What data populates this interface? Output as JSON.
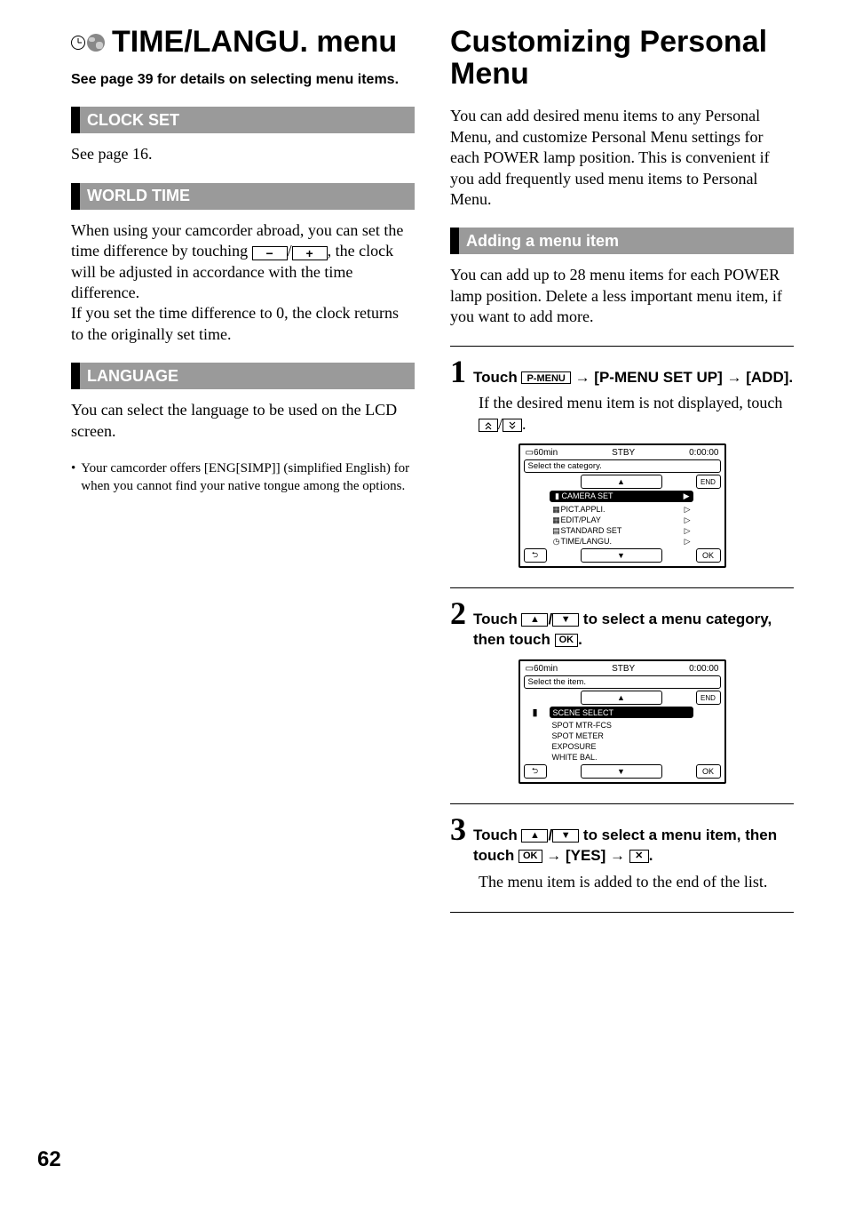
{
  "left": {
    "heading": "TIME/LANGU. menu",
    "subnote": "See page 39 for details on selecting menu items.",
    "sections": {
      "clock": {
        "title": "CLOCK SET",
        "body": "See page 16."
      },
      "world": {
        "title": "WORLD TIME",
        "body_pre": "When using your camcorder abroad, you can set the time difference by touching ",
        "body_post": ", the clock will be adjusted in accordance with the time difference.\nIf you set the time difference to 0, the clock returns to the originally set time."
      },
      "language": {
        "title": "LANGUAGE",
        "body": "You can select the language to be used on the LCD screen.",
        "bullet": "Your camcorder offers [ENG[SIMP]] (simplified English) for when you cannot find your native tongue among the options."
      }
    }
  },
  "right": {
    "heading": "Customizing Personal Menu",
    "intro": "You can add desired menu items to any Personal Menu, and customize Personal Menu settings for each POWER lamp position. This is convenient if you add frequently used menu items to Personal Menu.",
    "section_bar": "Adding a menu item",
    "add_intro": "You can add up to 28 menu items for each POWER lamp position. Delete a less important menu item, if you want to add more.",
    "steps": {
      "s1": {
        "num": "1",
        "head_pre": "Touch ",
        "pmenu": "P-MENU",
        "head_mid1": " → [P-MENU SET UP] → [ADD].",
        "sub_pre": "If the desired menu item is not displayed, touch "
      },
      "s2": {
        "num": "2",
        "head_pre": "Touch ",
        "head_mid": " to select a menu category, then touch ",
        "ok": "OK",
        "head_end": "."
      },
      "s3": {
        "num": "3",
        "head_pre": "Touch ",
        "head_mid": " to select a menu item, then touch ",
        "ok": "OK",
        "yes": " → [YES] → ",
        "head_end": ".",
        "sub": "The menu item is added to the end of the list."
      }
    },
    "lcd1": {
      "batt": "60min",
      "stby": "STBY",
      "time": "0:00:00",
      "title": "Select the category.",
      "end": "END",
      "ok": "OK",
      "items": [
        "CAMERA SET",
        "PICT.APPLI.",
        "EDIT/PLAY",
        "STANDARD SET",
        "TIME/LANGU."
      ]
    },
    "lcd2": {
      "batt": "60min",
      "stby": "STBY",
      "time": "0:00:00",
      "title": "Select the item.",
      "end": "END",
      "ok": "OK",
      "items": [
        "SCENE SELECT",
        "SPOT MTR-FCS",
        "SPOT METER",
        "EXPOSURE",
        "WHITE BAL."
      ]
    }
  },
  "page_number": "62"
}
